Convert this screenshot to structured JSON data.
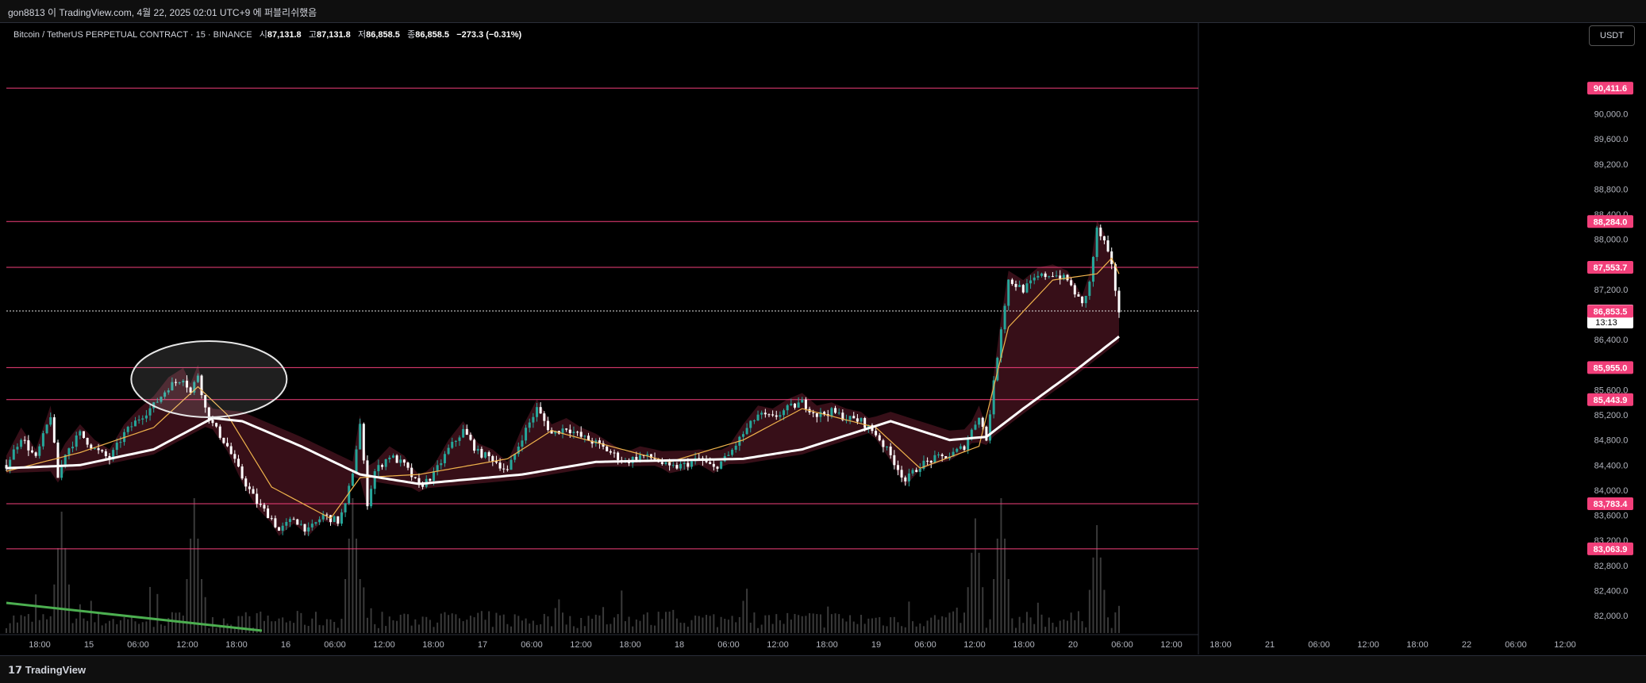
{
  "header": {
    "publish_text": "gon8813 이 TradingView.com, 4월 22, 2025 02:01 UTC+9 에 퍼블리쉬했음"
  },
  "legend": {
    "symbol": "Bitcoin / TetherUS PERPETUAL CONTRACT · 15 · BINANCE",
    "open_label": "시",
    "open": "87,131.8",
    "high_label": "고",
    "high": "87,131.8",
    "low_label": "저",
    "low": "86,858.5",
    "close_label": "종",
    "close": "86,858.5",
    "change": "−273.3 (−0.31%)"
  },
  "currency_button": "USDT",
  "footer": {
    "brand": "TradingView"
  },
  "colors": {
    "background": "#000000",
    "level_line": "#f23f7a",
    "candle_up": "#26a69a",
    "candle_down": "#ffffff",
    "ma_slow": "#ffffff",
    "ma_fast": "#f0b34c",
    "cloud": "#4a1420",
    "volume": "#3a3a3a",
    "trend_line": "#4caf50"
  },
  "chart_data": {
    "type": "candlestick",
    "title": "Bitcoin / TetherUS PERPETUAL CONTRACT · 15 · BINANCE",
    "ylim": [
      81800,
      90760
    ],
    "y_ticks": [
      "82,000.0",
      "82,400.0",
      "82,800.0",
      "83,200.0",
      "83,600.0",
      "84,000.0",
      "84,400.0",
      "84,800.0",
      "85,200.0",
      "85,600.0",
      "86,000.0",
      "86,400.0",
      "86,800.0",
      "87,200.0",
      "87,600.0",
      "88,000.0",
      "88,400.0",
      "88,800.0",
      "89,200.0",
      "89,600.0",
      "90,000.0",
      "90,400.0"
    ],
    "x_ticks": [
      "18:00",
      "15",
      "06:00",
      "12:00",
      "18:00",
      "16",
      "06:00",
      "12:00",
      "18:00",
      "17",
      "06:00",
      "12:00",
      "18:00",
      "18",
      "06:00",
      "12:00",
      "18:00",
      "19",
      "06:00",
      "12:00",
      "18:00",
      "20",
      "06:00",
      "12:00",
      "18:00",
      "21",
      "06:00",
      "12:00",
      "18:00",
      "22",
      "06:00",
      "12:00"
    ],
    "price_levels": [
      {
        "label": "90,411.6",
        "value": 90411.6
      },
      {
        "label": "88,284.0",
        "value": 88284.0
      },
      {
        "label": "87,553.7",
        "value": 87553.7
      },
      {
        "label": "85,955.0",
        "value": 85955.0
      },
      {
        "label": "85,443.9",
        "value": 85443.9
      },
      {
        "label": "83,783.4",
        "value": 83783.4
      },
      {
        "label": "83,063.9",
        "value": 83063.9
      }
    ],
    "current_price": {
      "label": "86,858.5",
      "countdown": "13:13",
      "value": 86858.5
    },
    "secondary_level": {
      "label": "86,853.5",
      "value": 86853.5
    },
    "price_path": [
      [
        0,
        84400
      ],
      [
        4,
        84850
      ],
      [
        8,
        84500
      ],
      [
        12,
        85200
      ],
      [
        14,
        84200
      ],
      [
        16,
        84600
      ],
      [
        20,
        84900
      ],
      [
        24,
        84650
      ],
      [
        28,
        84500
      ],
      [
        32,
        84900
      ],
      [
        36,
        85150
      ],
      [
        40,
        85350
      ],
      [
        44,
        85650
      ],
      [
        48,
        85800
      ],
      [
        50,
        85550
      ],
      [
        52,
        85850
      ],
      [
        54,
        85300
      ],
      [
        56,
        85050
      ],
      [
        60,
        84700
      ],
      [
        64,
        84200
      ],
      [
        68,
        83800
      ],
      [
        72,
        83550
      ],
      [
        74,
        83350
      ],
      [
        78,
        83550
      ],
      [
        82,
        83350
      ],
      [
        86,
        83600
      ],
      [
        90,
        83500
      ],
      [
        92,
        83750
      ],
      [
        94,
        84300
      ],
      [
        96,
        85050
      ],
      [
        98,
        83800
      ],
      [
        100,
        84300
      ],
      [
        104,
        84550
      ],
      [
        108,
        84400
      ],
      [
        112,
        84050
      ],
      [
        116,
        84250
      ],
      [
        120,
        84650
      ],
      [
        124,
        84950
      ],
      [
        128,
        84600
      ],
      [
        132,
        84500
      ],
      [
        136,
        84300
      ],
      [
        140,
        84850
      ],
      [
        144,
        85300
      ],
      [
        148,
        84900
      ],
      [
        152,
        85000
      ],
      [
        156,
        84850
      ],
      [
        160,
        84750
      ],
      [
        164,
        84600
      ],
      [
        168,
        84450
      ],
      [
        172,
        84550
      ],
      [
        176,
        84500
      ],
      [
        180,
        84350
      ],
      [
        184,
        84400
      ],
      [
        188,
        84500
      ],
      [
        192,
        84350
      ],
      [
        196,
        84550
      ],
      [
        200,
        84900
      ],
      [
        204,
        85200
      ],
      [
        208,
        85150
      ],
      [
        212,
        85300
      ],
      [
        216,
        85400
      ],
      [
        220,
        85200
      ],
      [
        224,
        85250
      ],
      [
        228,
        85150
      ],
      [
        232,
        85100
      ],
      [
        236,
        84900
      ],
      [
        240,
        84550
      ],
      [
        244,
        84150
      ],
      [
        248,
        84400
      ],
      [
        252,
        84500
      ],
      [
        256,
        84550
      ],
      [
        260,
        84700
      ],
      [
        264,
        85200
      ],
      [
        266,
        84800
      ],
      [
        270,
        86600
      ],
      [
        272,
        87350
      ],
      [
        276,
        87200
      ],
      [
        280,
        87400
      ],
      [
        284,
        87450
      ],
      [
        288,
        87350
      ],
      [
        290,
        87150
      ],
      [
        292,
        86950
      ],
      [
        294,
        87300
      ],
      [
        296,
        88150
      ],
      [
        298,
        87950
      ],
      [
        300,
        87550
      ],
      [
        302,
        86858
      ]
    ],
    "ma_slow": [
      [
        0,
        84350
      ],
      [
        20,
        84400
      ],
      [
        40,
        84650
      ],
      [
        56,
        85150
      ],
      [
        64,
        85100
      ],
      [
        80,
        84700
      ],
      [
        96,
        84250
      ],
      [
        112,
        84100
      ],
      [
        140,
        84250
      ],
      [
        160,
        84450
      ],
      [
        200,
        84500
      ],
      [
        216,
        84650
      ],
      [
        240,
        85100
      ],
      [
        256,
        84800
      ],
      [
        266,
        84850
      ],
      [
        276,
        85300
      ],
      [
        290,
        85900
      ],
      [
        302,
        86450
      ]
    ],
    "ma_fast": [
      [
        0,
        84300
      ],
      [
        20,
        84600
      ],
      [
        40,
        85000
      ],
      [
        52,
        85650
      ],
      [
        60,
        85200
      ],
      [
        72,
        84050
      ],
      [
        88,
        83550
      ],
      [
        96,
        84200
      ],
      [
        112,
        84250
      ],
      [
        136,
        84500
      ],
      [
        148,
        84950
      ],
      [
        180,
        84450
      ],
      [
        200,
        84800
      ],
      [
        216,
        85300
      ],
      [
        236,
        85000
      ],
      [
        248,
        84350
      ],
      [
        264,
        84700
      ],
      [
        272,
        86600
      ],
      [
        284,
        87350
      ],
      [
        296,
        87450
      ],
      [
        300,
        87700
      ],
      [
        302,
        87450
      ]
    ],
    "volume_spikes": [
      [
        15,
        0.9
      ],
      [
        51,
        1.0
      ],
      [
        94,
        1.0
      ],
      [
        263,
        0.85
      ],
      [
        270,
        1.0
      ],
      [
        296,
        0.8
      ]
    ]
  }
}
